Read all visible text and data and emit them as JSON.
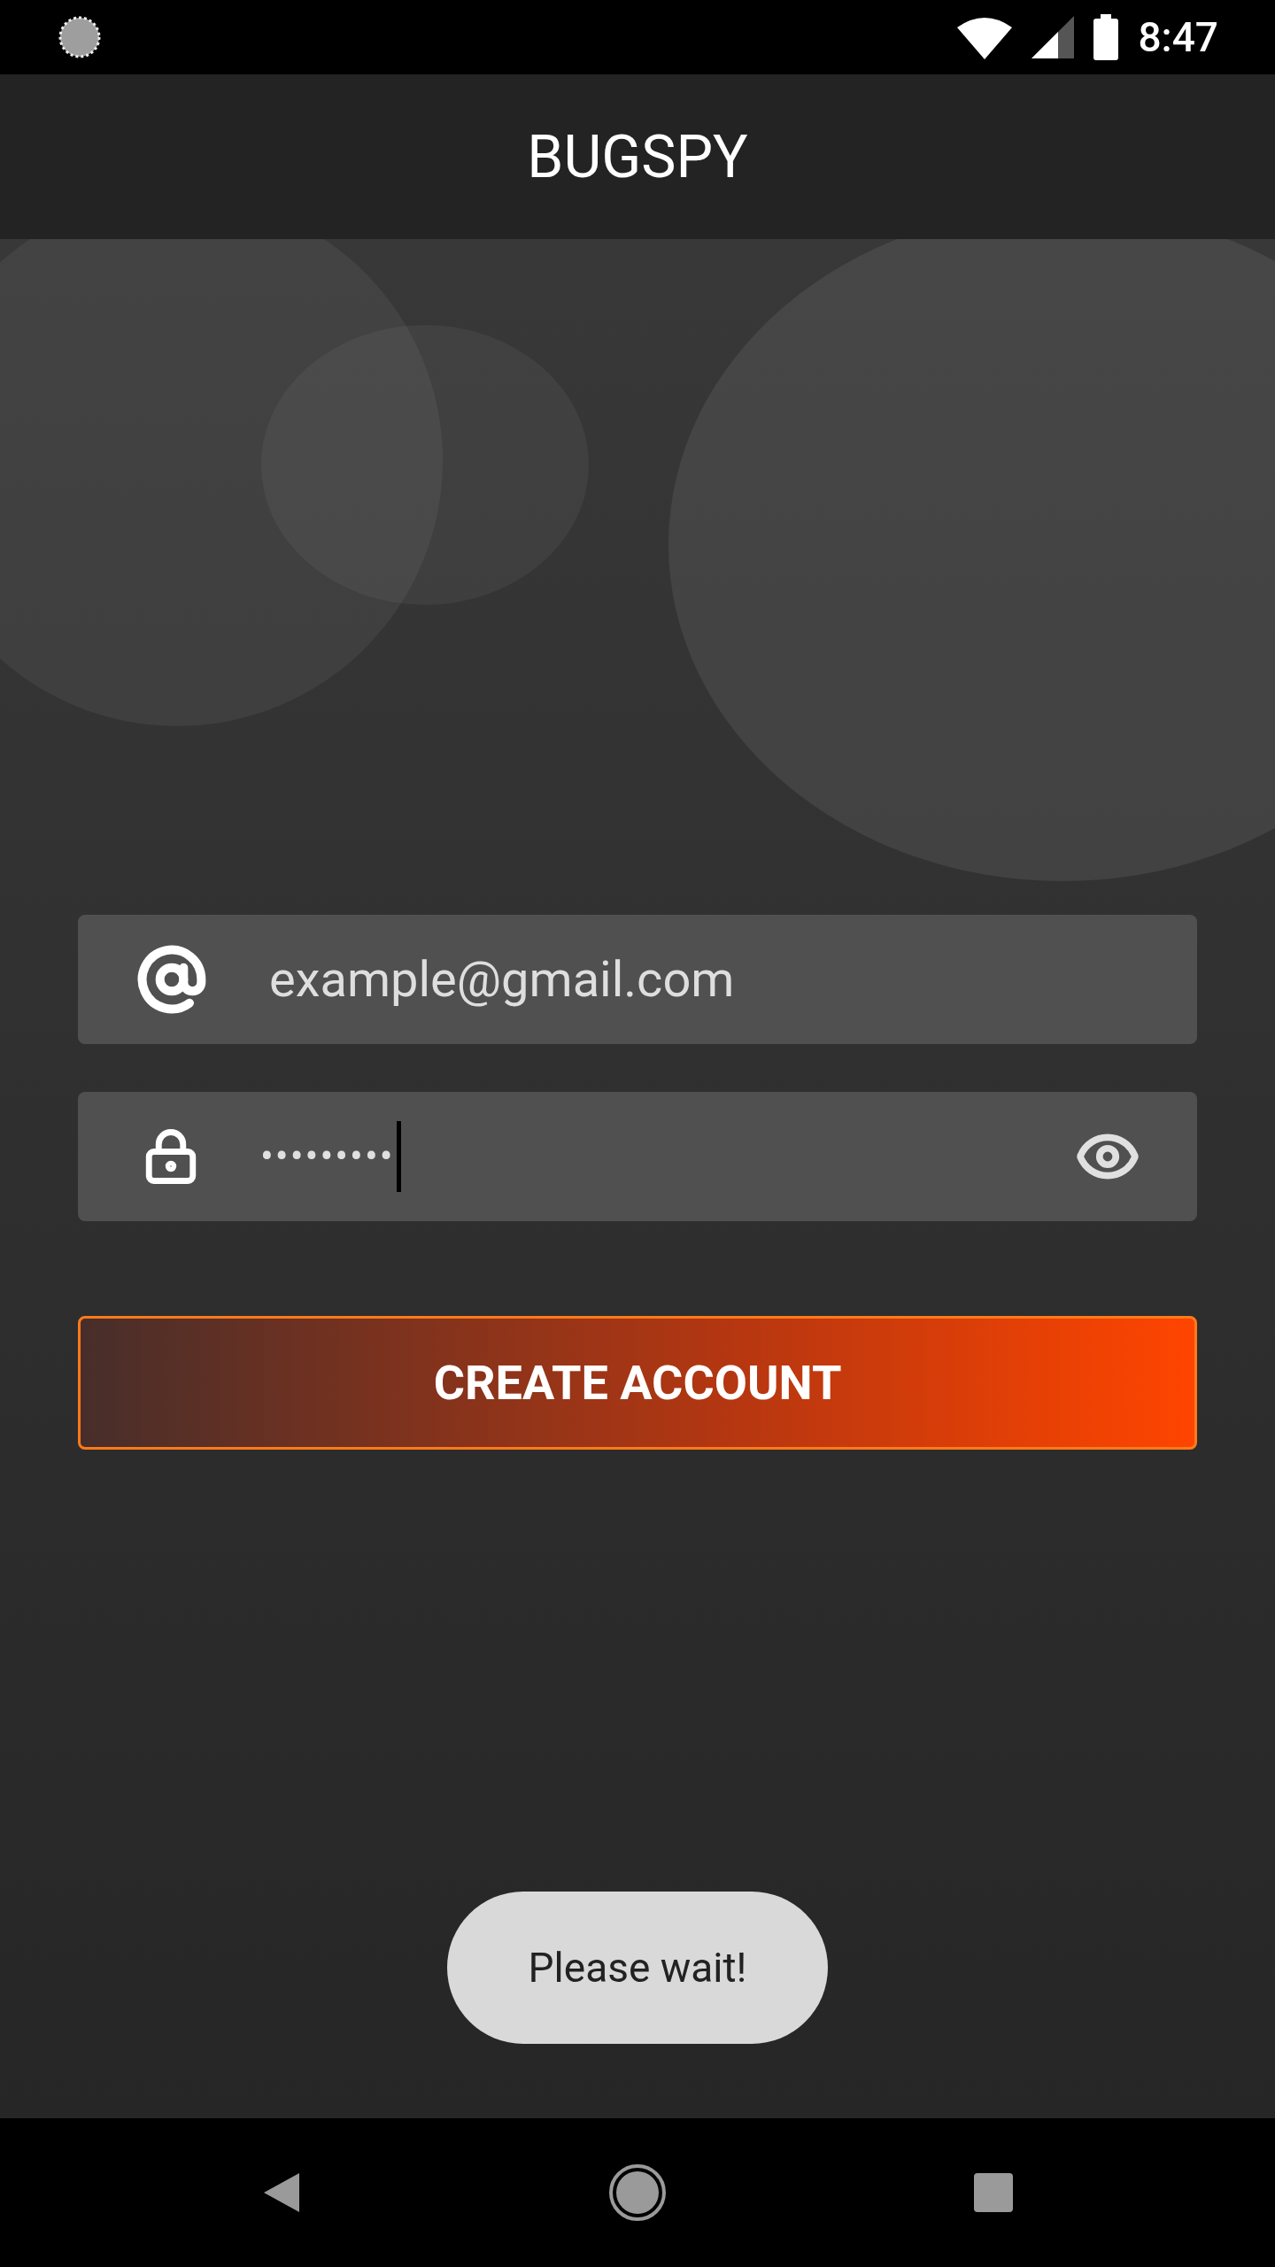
{
  "status_bar": {
    "time": "8:47"
  },
  "app_bar": {
    "title": "BUGSPY"
  },
  "form": {
    "email": {
      "value": "example@gmail.com"
    },
    "password": {
      "value": "•••••••••",
      "focused": true
    },
    "button": {
      "label": "CREATE ACCOUNT"
    }
  },
  "toast": {
    "text": "Please wait!"
  }
}
